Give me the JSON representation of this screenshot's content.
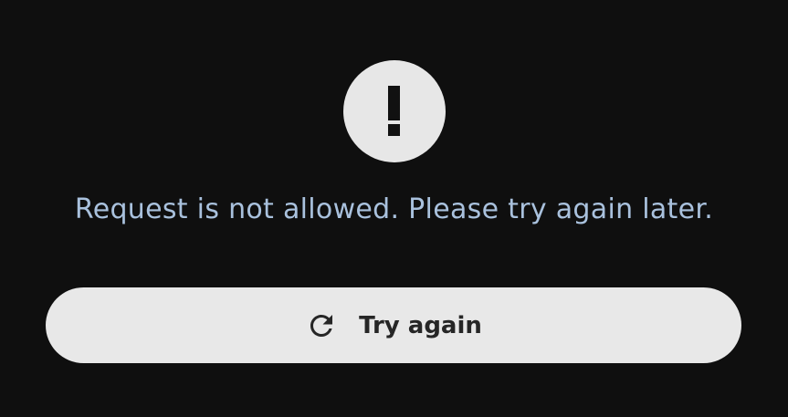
{
  "error": {
    "icon": "exclamation-icon",
    "message": "Request is not allowed. Please try again later."
  },
  "retry": {
    "icon": "refresh-icon",
    "label": "Try again"
  },
  "colors": {
    "background": "#0f0f0f",
    "message_text": "#a9c1dd",
    "surface": "#e8e8e8",
    "button_text": "#262626"
  }
}
